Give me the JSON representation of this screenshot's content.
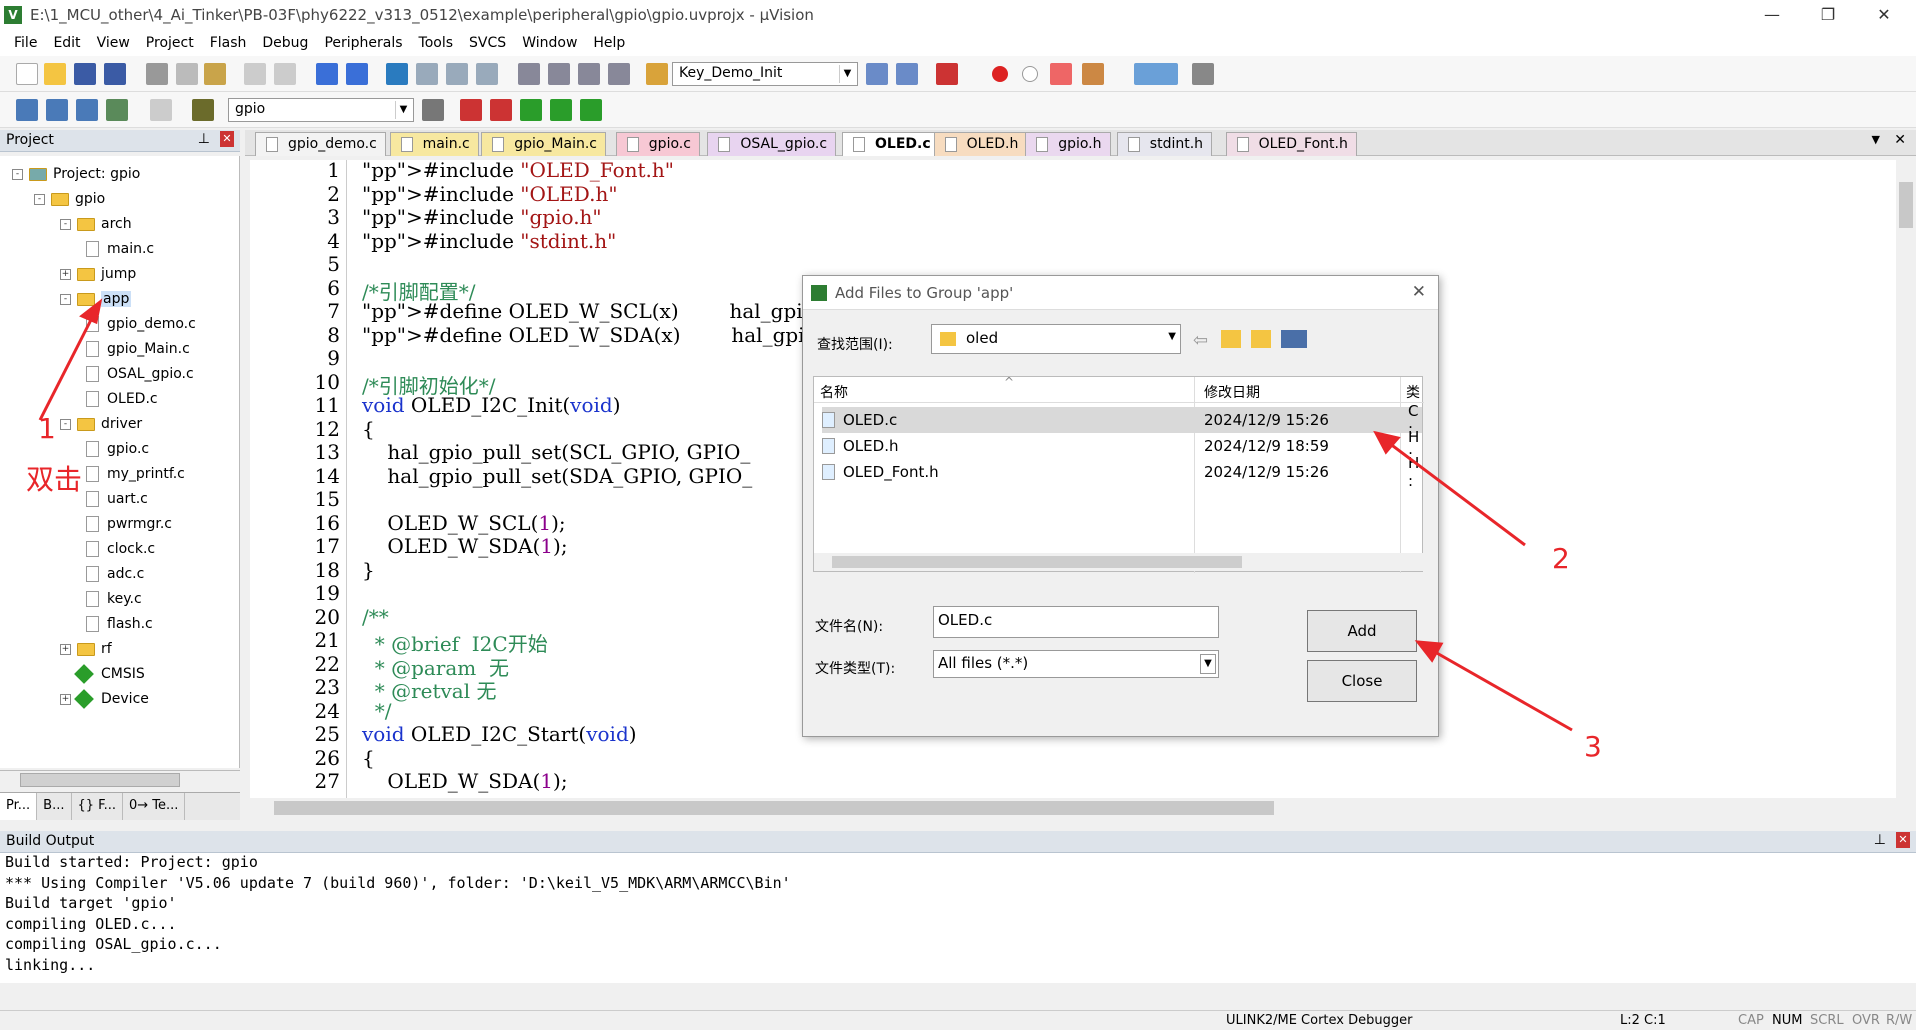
{
  "window": {
    "title": "E:\\1_MCU_other\\4_Ai_Tinker\\PB-03F\\phy6222_v313_0512\\example\\peripheral\\gpio\\gpio.uvprojx - µVision",
    "app_icon": "keil-icon"
  },
  "menu": [
    "File",
    "Edit",
    "View",
    "Project",
    "Flash",
    "Debug",
    "Peripherals",
    "Tools",
    "SVCS",
    "Window",
    "Help"
  ],
  "toolbar": {
    "function_combo": "Key_Demo_Init",
    "target_combo": "gpio"
  },
  "project_panel": {
    "header": "Project",
    "tree": [
      {
        "label": "Project: gpio",
        "level": 0,
        "type": "project",
        "exp": "-"
      },
      {
        "label": "gpio",
        "level": 1,
        "type": "target",
        "exp": "-"
      },
      {
        "label": "arch",
        "level": 2,
        "type": "folder",
        "exp": "-"
      },
      {
        "label": "main.c",
        "level": 3,
        "type": "file"
      },
      {
        "label": "jump",
        "level": 2,
        "type": "folder",
        "exp": "+"
      },
      {
        "label": "app",
        "level": 2,
        "type": "folder",
        "exp": "-",
        "selected": true
      },
      {
        "label": "gpio_demo.c",
        "level": 3,
        "type": "file"
      },
      {
        "label": "gpio_Main.c",
        "level": 3,
        "type": "file"
      },
      {
        "label": "OSAL_gpio.c",
        "level": 3,
        "type": "file"
      },
      {
        "label": "OLED.c",
        "level": 3,
        "type": "file"
      },
      {
        "label": "driver",
        "level": 2,
        "type": "folder",
        "exp": "-"
      },
      {
        "label": "gpio.c",
        "level": 3,
        "type": "file"
      },
      {
        "label": "my_printf.c",
        "level": 3,
        "type": "file"
      },
      {
        "label": "uart.c",
        "level": 3,
        "type": "file"
      },
      {
        "label": "pwrmgr.c",
        "level": 3,
        "type": "file"
      },
      {
        "label": "clock.c",
        "level": 3,
        "type": "file"
      },
      {
        "label": "adc.c",
        "level": 3,
        "type": "file"
      },
      {
        "label": "key.c",
        "level": 3,
        "type": "file"
      },
      {
        "label": "flash.c",
        "level": 3,
        "type": "file"
      },
      {
        "label": "rf",
        "level": 2,
        "type": "folder",
        "exp": "+"
      },
      {
        "label": "CMSIS",
        "level": 2,
        "type": "component"
      },
      {
        "label": "Device",
        "level": 2,
        "type": "component",
        "exp": "+"
      }
    ],
    "bottom_tabs": [
      "Pr...",
      "B...",
      "{} F...",
      "0→ Te..."
    ]
  },
  "editor_tabs": [
    {
      "label": "gpio_demo.c",
      "color": "#f3f3f3"
    },
    {
      "label": "main.c",
      "color": "#f7e8a0"
    },
    {
      "label": "gpio_Main.c",
      "color": "#f7e8a0"
    },
    {
      "label": "gpio.c",
      "color": "#f7c8d4"
    },
    {
      "label": "OSAL_gpio.c",
      "color": "#e8d4f0"
    },
    {
      "label": "OLED.c",
      "color": "#e0e8f0",
      "active": true
    },
    {
      "label": "OLED.h",
      "color": "#f7dcc0"
    },
    {
      "label": "gpio.h",
      "color": "#ead8ef"
    },
    {
      "label": "stdint.h",
      "color": "#e6e6ee"
    },
    {
      "label": "OLED_Font.h",
      "color": "#f0dde6"
    }
  ],
  "code_lines": [
    [
      "1",
      "#include \"OLED_Font.h\""
    ],
    [
      "2",
      "#include \"OLED.h\""
    ],
    [
      "3",
      "#include \"gpio.h\""
    ],
    [
      "4",
      "#include \"stdint.h\""
    ],
    [
      "5",
      ""
    ],
    [
      "6",
      "/*引脚配置*/"
    ],
    [
      "7",
      "#define OLED_W_SCL(x)        hal_gpio"
    ],
    [
      "8",
      "#define OLED_W_SDA(x)        hal_gpio"
    ],
    [
      "9",
      ""
    ],
    [
      "10",
      "/*引脚初始化*/"
    ],
    [
      "11",
      "void OLED_I2C_Init(void)"
    ],
    [
      "12",
      "{"
    ],
    [
      "13",
      "    hal_gpio_pull_set(SCL_GPIO, GPIO_"
    ],
    [
      "14",
      "    hal_gpio_pull_set(SDA_GPIO, GPIO_"
    ],
    [
      "15",
      ""
    ],
    [
      "16",
      "    OLED_W_SCL(1);"
    ],
    [
      "17",
      "    OLED_W_SDA(1);"
    ],
    [
      "18",
      "}"
    ],
    [
      "19",
      ""
    ],
    [
      "20",
      "/**"
    ],
    [
      "21",
      "  * @brief  I2C开始"
    ],
    [
      "22",
      "  * @param  无"
    ],
    [
      "23",
      "  * @retval 无"
    ],
    [
      "24",
      "  */"
    ],
    [
      "25",
      "void OLED_I2C_Start(void)"
    ],
    [
      "26",
      "{"
    ],
    [
      "27",
      "    OLED_W_SDA(1);"
    ]
  ],
  "dialog": {
    "title": "Add Files to Group 'app'",
    "lookin_label": "查找范围(I):",
    "lookin_value": "oled",
    "col_name": "名称",
    "col_date": "修改日期",
    "col_type": "类",
    "files": [
      {
        "name": "OLED.c",
        "date": "2024/12/9 15:26",
        "type": "C :"
      },
      {
        "name": "OLED.h",
        "date": "2024/12/9 18:59",
        "type": "H :"
      },
      {
        "name": "OLED_Font.h",
        "date": "2024/12/9 15:26",
        "type": "H :"
      }
    ],
    "filename_label": "文件名(N):",
    "filename_value": "OLED.c",
    "filetype_label": "文件类型(T):",
    "filetype_value": "All files (*.*)",
    "add_button": "Add",
    "close_button": "Close"
  },
  "build_output": {
    "header": "Build Output",
    "lines": [
      "Build started: Project: gpio",
      "*** Using Compiler 'V5.06 update 7 (build 960)', folder: 'D:\\keil_V5_MDK\\ARM\\ARMCC\\Bin'",
      "Build target 'gpio'",
      "compiling OLED.c...",
      "compiling OSAL_gpio.c...",
      "linking..."
    ]
  },
  "status": {
    "debugger": "ULINK2/ME Cortex Debugger",
    "position": "L:2 C:1",
    "caps": "CAP",
    "num": "NUM",
    "scrl": "SCRL",
    "ovr": "OVR",
    "rw": "R/W"
  },
  "annotations": {
    "one": "1",
    "dblclick": "双击",
    "two": "2",
    "three": "3"
  }
}
